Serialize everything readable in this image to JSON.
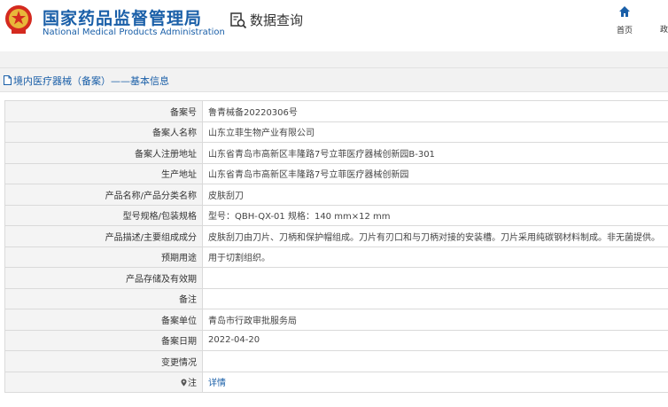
{
  "header": {
    "org_name_cn": "国家药品监督管理局",
    "org_name_en": "National Medical Products Administration",
    "query_title": "数据查询",
    "nav": {
      "home": "首页",
      "other": "政"
    }
  },
  "breadcrumb": "境内医疗器械（备案）——基本信息",
  "record": {
    "rows": [
      {
        "label": "备案号",
        "value": "鲁青械备20220306号"
      },
      {
        "label": "备案人名称",
        "value": "山东立菲生物产业有限公司"
      },
      {
        "label": "备案人注册地址",
        "value": "山东省青岛市高新区丰隆路7号立菲医疗器械创新园B-301"
      },
      {
        "label": "生产地址",
        "value": "山东省青岛市高新区丰隆路7号立菲医疗器械创新园"
      },
      {
        "label": "产品名称/产品分类名称",
        "value": "皮肤刮刀"
      },
      {
        "label": "型号规格/包装规格",
        "value": "型号：QBH-QX-01 规格：140 mm×12 mm"
      },
      {
        "label": "产品描述/主要组成成分",
        "value": "皮肤刮刀由刀片、刀柄和保护帽组成。刀片有刃口和与刀柄对接的安装槽。刀片采用纯碳钢材料制成。非无菌提供。"
      },
      {
        "label": "预期用途",
        "value": "用于切割组织。"
      },
      {
        "label": "产品存储及有效期",
        "value": ""
      },
      {
        "label": "备注",
        "value": ""
      },
      {
        "label": "备案单位",
        "value": "青岛市行政审批服务局"
      },
      {
        "label": "备案日期",
        "value": "2022-04-20"
      },
      {
        "label": "变更情况",
        "value": ""
      },
      {
        "label": "注",
        "value": "详情"
      }
    ]
  }
}
